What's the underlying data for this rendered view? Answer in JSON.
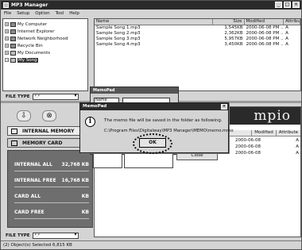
{
  "window": {
    "title": "MP3 Manager",
    "menu": [
      "File",
      "Setup",
      "Option",
      "Tool",
      "Help"
    ]
  },
  "tree": {
    "items": [
      {
        "label": "My Computer",
        "expander": "+",
        "icon": "computer-icon"
      },
      {
        "label": "Internet Explorer",
        "expander": "+",
        "icon": "globe-icon"
      },
      {
        "label": "Network Neighborhood",
        "expander": "+",
        "icon": "network-icon"
      },
      {
        "label": "Recycle Bin",
        "expander": "+",
        "icon": "recycle-bin-icon"
      },
      {
        "label": "My Documents",
        "expander": "+",
        "icon": "folder-icon"
      },
      {
        "label": "My Song",
        "expander": "−",
        "icon": "folder-icon",
        "selected": true
      }
    ]
  },
  "filelist": {
    "columns": [
      "Name",
      "Size",
      "Modified",
      "Attribute"
    ],
    "rows": [
      {
        "name": "Sample Song 1.mp3",
        "size": "1,545KB",
        "modified": "2000-06-08 PM ...",
        "attr": "A"
      },
      {
        "name": "Sample Song 2.mp3",
        "size": "2,362KB",
        "modified": "2000-06-08 PM ...",
        "attr": "A"
      },
      {
        "name": "Sample Song 3.mp3",
        "size": "5,957KB",
        "modified": "2000-06-08 PM ...",
        "attr": "A"
      },
      {
        "name": "Sample Song 4.mp3",
        "size": "3,450KB",
        "modified": "2000-06-08 PM ...",
        "attr": "A"
      }
    ]
  },
  "filetype_top": {
    "label": "FILE TYPE",
    "value": "*.*"
  },
  "filetype_bottom": {
    "label": "FILE TYPE",
    "value": "*.*"
  },
  "device": {
    "internal_memory": "INTERNAL MEMORY",
    "memory_card": "MEMORY CARD",
    "stats": [
      {
        "label": "INTERNAL ALL",
        "value": "32,768 KB"
      },
      {
        "label": "INTERNAL FREE",
        "value": "16,768 KB"
      },
      {
        "label": "CARD ALL",
        "value": "KB"
      },
      {
        "label": "CARD FREE",
        "value": "KB"
      }
    ]
  },
  "lower_pane": {
    "brand": "mpio",
    "columns": [
      "Modified",
      "Attribute"
    ],
    "rows": [
      {
        "modified": "2000-06-08",
        "attr": "A"
      },
      {
        "modified": "2000-06-08",
        "attr": "A"
      },
      {
        "modified": "2000-06-08",
        "attr": "A"
      }
    ]
  },
  "memopad_behind": {
    "title": "MemoPad",
    "name_label": "Name"
  },
  "dialog": {
    "title": "MemoPad",
    "message": "The memo file will be saved in the folder as following.",
    "path": "C:\\Program Files\\Digitalway\\MP3 Manager\\MEMO\\memo.mmo",
    "ok_label": "OK",
    "close_label": "Close"
  },
  "status": {
    "text": "(2) Object(s) Selected  6,815 KB"
  }
}
